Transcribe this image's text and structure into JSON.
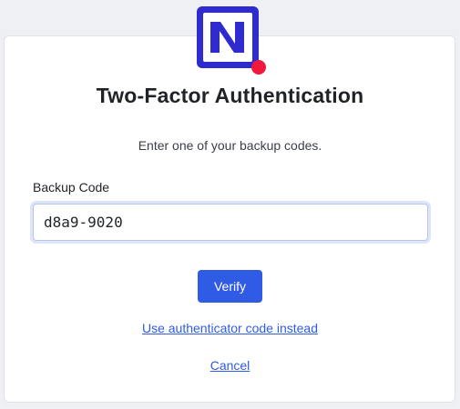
{
  "header": {
    "logo_icon": "brand-n-logo-icon",
    "title": "Two-Factor Authentication",
    "subtitle": "Enter one of your backup codes."
  },
  "form": {
    "backup_code_label": "Backup Code",
    "backup_code_value": "d8a9-9020",
    "verify_label": "Verify"
  },
  "links": {
    "use_authenticator": "Use authenticator code instead",
    "cancel": "Cancel"
  },
  "colors": {
    "brand_blue": "#2f2bcf",
    "accent_red": "#f0183c",
    "primary_button": "#2f5be5",
    "link": "#2f5be5"
  }
}
